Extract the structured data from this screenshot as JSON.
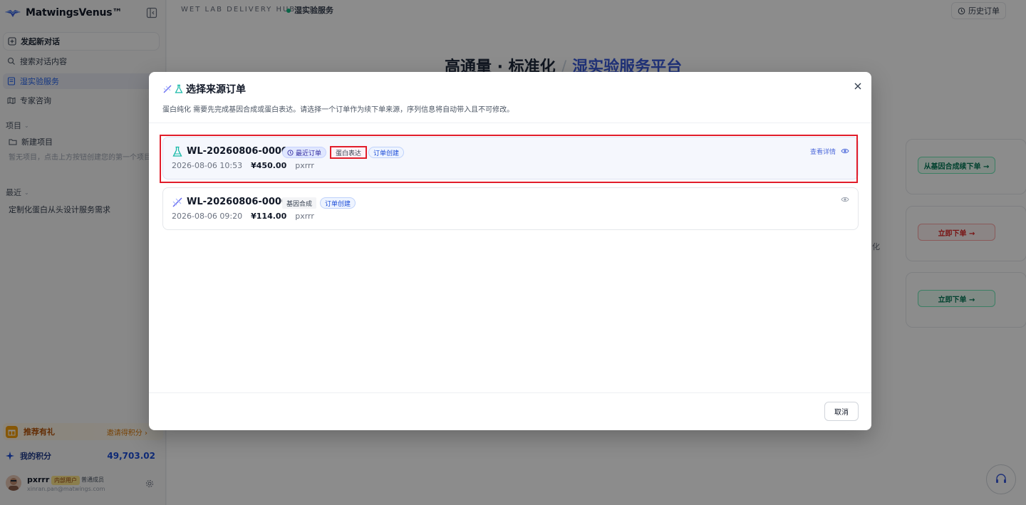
{
  "sidebar": {
    "brand": "MatwingsVenus™",
    "new_chat": "发起新对话",
    "nav": [
      {
        "label": "搜索对话内容",
        "icon": "search-icon"
      },
      {
        "label": "湿实验服务",
        "icon": "document-icon",
        "active": true
      },
      {
        "label": "专家咨询",
        "icon": "map-icon"
      }
    ],
    "projects_header": "项目",
    "new_project": "新建项目",
    "empty_hint": "暂无项目，点击上方按钮创建您的第一个项目",
    "recent_header": "最近",
    "recent_items": [
      "定制化蛋白从头设计服务需求"
    ],
    "referral": {
      "title": "推荐有礼",
      "link": "邀请得积分 ›"
    },
    "points": {
      "label": "我的积分",
      "value": "49,703.02"
    },
    "user": {
      "name": "pxrrr",
      "badge_internal": "内部用户",
      "badge_normal": "普通成员",
      "email": "xinran.pan@matwings.com"
    }
  },
  "main": {
    "hub_label": "WET LAB DELIVERY HUB",
    "hub_service": "湿实验服务",
    "history_button": "历史订单",
    "hero": {
      "part1": "高通量 · 标准化",
      "slash": "/",
      "part2": "湿实验服务平台"
    },
    "background_buttons": [
      "从基因合成续下单 →",
      "立即下单 →",
      "立即下单 →"
    ],
    "partial_text": "化"
  },
  "modal": {
    "title": "选择来源订单",
    "description": "蛋白纯化 需要先完成基因合成或蛋白表达。请选择一个订单作为续下单来源，序列信息将自动带入且不可修改。",
    "orders": [
      {
        "id": "WL-20260806-00002",
        "tags": [
          "最近订单",
          "蛋白表达",
          "订单创建"
        ],
        "datetime": "2026-08-06 10:53",
        "amount": "¥450.00",
        "user": "pxrrr",
        "view_label": "查看详情"
      },
      {
        "id": "WL-20260806-00001",
        "tags": [
          "基因合成",
          "订单创建"
        ],
        "datetime": "2026-08-06 09:20",
        "amount": "¥114.00",
        "user": "pxrrr",
        "view_label": ""
      }
    ],
    "cancel": "取消"
  },
  "colors": {
    "accent": "#3b5bdb",
    "highlight": "#e11d2a",
    "success": "#10b981"
  }
}
